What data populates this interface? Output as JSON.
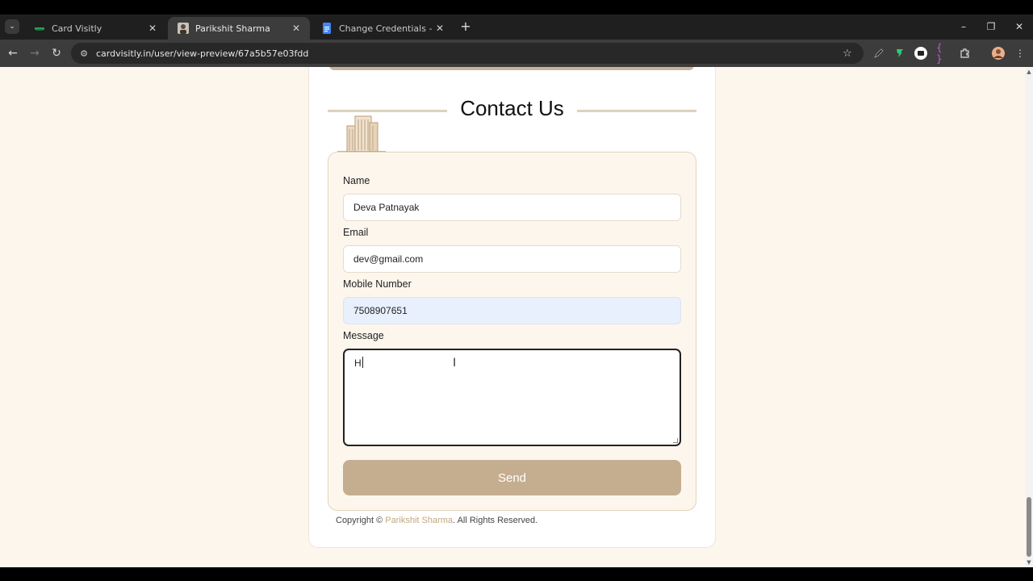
{
  "browser": {
    "tabs": [
      {
        "title": "Card Visitly",
        "active": false
      },
      {
        "title": "Parikshit Sharma",
        "active": true
      },
      {
        "title": "Change Credentials - Google Do",
        "active": false
      }
    ],
    "url": "cardvisitly.in/user/view-preview/67a5b57e03fdd",
    "icons": {
      "tab_search": "chevron-down-icon",
      "new_tab": "+",
      "minimize": "–",
      "restore": "❐",
      "close": "✕",
      "back": "←",
      "forward": "→",
      "reload": "↻",
      "site_info": "⚙",
      "bookmark": "☆"
    }
  },
  "page": {
    "heading": "Contact Us",
    "form": {
      "name_label": "Name",
      "name_value": "Deva Patnayak",
      "email_label": "Email",
      "email_value": "dev@gmail.com",
      "mobile_label": "Mobile Number",
      "mobile_value": "7508907651",
      "message_label": "Message",
      "message_value": "H",
      "send_label": "Send"
    },
    "footer": {
      "prefix": "Copyright © ",
      "name": "Parikshit Sharma",
      "suffix": ". All Rights Reserved."
    }
  },
  "colors": {
    "page_bg": "#fdf6ed",
    "accent": "#c5ad90",
    "link": "#c1a77f",
    "autofill": "#e8f0fe"
  }
}
